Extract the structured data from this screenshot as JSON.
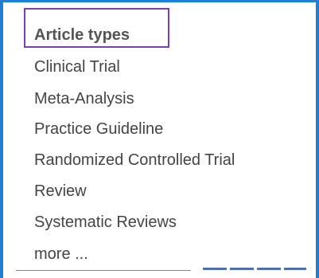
{
  "filter": {
    "heading": "Article types",
    "items": [
      "Clinical Trial",
      "Meta-Analysis",
      "Practice Guideline",
      "Randomized Controlled Trial",
      "Review",
      "Systematic Reviews"
    ],
    "more_label": "more ..."
  },
  "colors": {
    "frame_border": "#1f7fd6",
    "highlight_box": "#7b3fb3",
    "text": "#444444"
  }
}
